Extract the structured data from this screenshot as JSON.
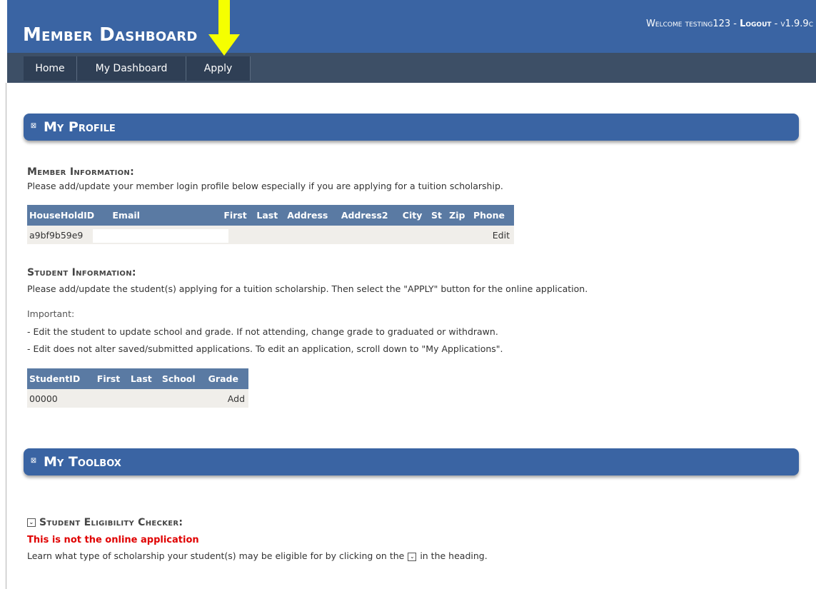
{
  "header": {
    "title": "Member Dashboard",
    "welcome": "Welcome testing123 - ",
    "logout": "Logout",
    "version": " - v1.9.9c"
  },
  "nav": {
    "items": [
      {
        "label": "Home"
      },
      {
        "label": "My Dashboard"
      },
      {
        "label": "Apply"
      }
    ]
  },
  "profile": {
    "section_title": "My Profile",
    "member_heading": "Member Information:",
    "member_text": "Please add/update your member login profile below especially if you are applying for a tuition scholarship.",
    "member_table": {
      "headers": [
        "HouseHoldID",
        "Email",
        "First",
        "Last",
        "Address",
        "Address2",
        "City",
        "St",
        "Zip",
        "Phone"
      ],
      "row": {
        "householdid": "a9bf9b59e9",
        "action": "Edit"
      }
    },
    "student_heading": "Student Information:",
    "student_text": "Please add/update the student(s) applying for a tuition scholarship. Then select the \"APPLY\" button for the online application.",
    "important_label": "Important:",
    "important_lines": [
      "- Edit the student to update school and grade. If not attending, change grade to graduated or withdrawn.",
      "- Edit does not alter saved/submitted applications. To edit an application, scroll down to \"My Applications\"."
    ],
    "student_table": {
      "headers": [
        "StudentID",
        "First",
        "Last",
        "School",
        "Grade"
      ],
      "row": {
        "studentid": "00000",
        "action": "Add"
      }
    }
  },
  "toolbox": {
    "section_title": "My Toolbox",
    "checker_heading": "Student Eligibility Checker:",
    "red_note": "This is not the online application",
    "checker_text_before": "Learn what type of scholarship your student(s) may be eligible for by clicking on the",
    "checker_text_after": "in the heading."
  },
  "colors": {
    "brand_blue": "#3a64a3",
    "nav_dark": "#3d4f66",
    "annotation_arrow": "#f5ff00",
    "alert_red": "#e00000",
    "link": "#2a6bd6"
  }
}
